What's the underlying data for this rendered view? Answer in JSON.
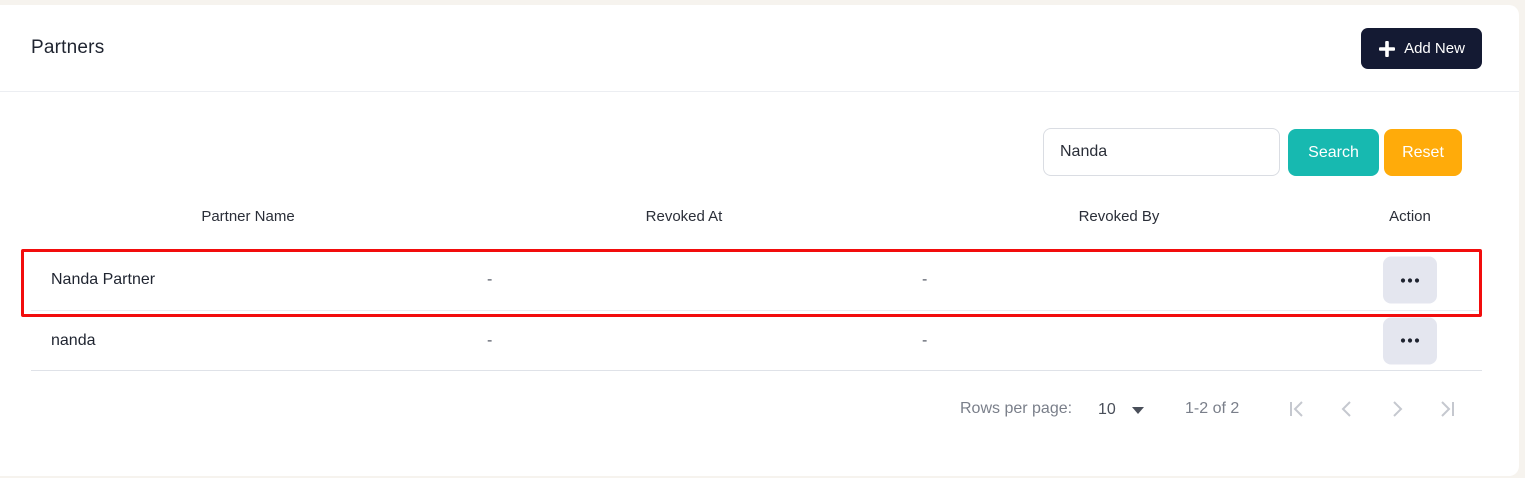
{
  "header": {
    "title": "Partners",
    "add_button_label": "Add New"
  },
  "filters": {
    "search_value": "Nanda",
    "search_button_label": "Search",
    "reset_button_label": "Reset"
  },
  "table": {
    "columns": [
      "Partner Name",
      "Revoked At",
      "Revoked By",
      "Action"
    ],
    "rows": [
      {
        "partner_name": "Nanda Partner",
        "revoked_at": "-",
        "revoked_by": "-",
        "highlighted": true
      },
      {
        "partner_name": "nanda",
        "revoked_at": "-",
        "revoked_by": "-",
        "highlighted": false
      }
    ]
  },
  "pagination": {
    "rows_per_page_label": "Rows per page:",
    "rows_per_page_value": "10",
    "range_text": "1-2 of 2"
  },
  "icons": {
    "add": "plus-icon",
    "row_action": "more-horizontal-icon",
    "dropdown": "caret-down-icon",
    "first_page": "first-page-icon",
    "prev_page": "chevron-left-icon",
    "next_page": "chevron-right-icon",
    "last_page": "last-page-icon"
  },
  "colors": {
    "primary_dark": "#141a33",
    "search_teal": "#17b9b0",
    "reset_orange": "#ffab0a",
    "highlight_red": "#f20d0d",
    "action_bg": "#e4e6ef"
  }
}
